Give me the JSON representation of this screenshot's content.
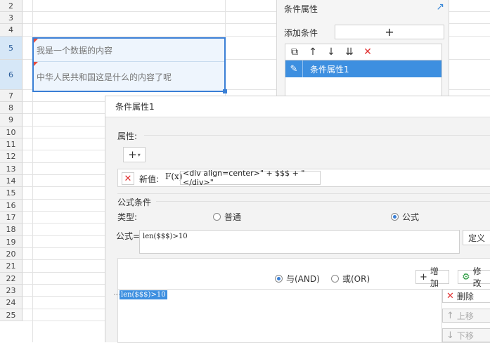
{
  "sheet": {
    "rows": [
      {
        "num": "2",
        "height": 17
      },
      {
        "num": "3",
        "height": 17
      },
      {
        "num": "4",
        "height": 18
      },
      {
        "num": "5",
        "height": 33,
        "sel": true
      },
      {
        "num": "6",
        "height": 43,
        "sel": true
      },
      {
        "num": "7",
        "height": 17
      },
      {
        "num": "8",
        "height": 17
      },
      {
        "num": "9",
        "height": 18
      },
      {
        "num": "10",
        "height": 17
      },
      {
        "num": "11",
        "height": 17
      },
      {
        "num": "12",
        "height": 18
      },
      {
        "num": "13",
        "height": 17
      },
      {
        "num": "14",
        "height": 17
      },
      {
        "num": "15",
        "height": 18
      },
      {
        "num": "16",
        "height": 17
      },
      {
        "num": "17",
        "height": 17
      },
      {
        "num": "18",
        "height": 18
      },
      {
        "num": "19",
        "height": 17
      },
      {
        "num": "20",
        "height": 17
      },
      {
        "num": "21",
        "height": 18
      },
      {
        "num": "22",
        "height": 17
      },
      {
        "num": "23",
        "height": 17
      },
      {
        "num": "24",
        "height": 18
      },
      {
        "num": "25",
        "height": 17
      }
    ],
    "cell_a5": "我是一个数据的内容",
    "cell_a6": "中华人民共和国这是什么的内容了呢"
  },
  "cond_panel": {
    "title": "条件属性",
    "add_label": "添加条件",
    "add_icon": "+",
    "item_label": "条件属性1"
  },
  "dialog": {
    "title": "条件属性1",
    "attr_label": "属性:",
    "add_prop_icon": "+",
    "new_value_label": "新值:",
    "fx_label": "F(x)",
    "value": "<div align=center>\" + $$$ + \"</div>\"",
    "formula_section": "公式条件",
    "type_label": "类型:",
    "type_normal": "普通",
    "type_formula": "公式",
    "formula_label": "公式=",
    "formula_value": "len($$$)>10",
    "define_button": "定义",
    "and_label": "与(AND)",
    "or_label": "或(OR)",
    "add_button": "增加",
    "modify_button": "修改",
    "delete_button": "删除",
    "move_up_button": "上移",
    "move_down_button": "下移",
    "tree_item": "len($$$)>10"
  },
  "colors": {
    "accent": "#3d8fe0",
    "danger": "#e03131",
    "selection": "#3a7fd5"
  }
}
